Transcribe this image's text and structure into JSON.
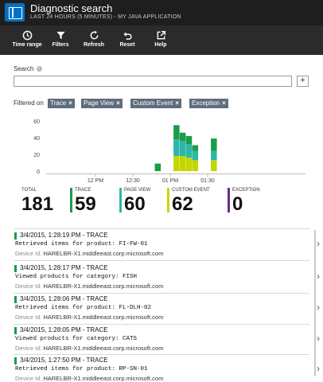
{
  "header": {
    "title": "Diagnostic search",
    "subtitle": "LAST 24 HOURS (5 MINUTES) - MY JAVA APPLICATION",
    "icon": "diagnostic-search-icon"
  },
  "toolbar": {
    "items": [
      {
        "label": "Time range",
        "icon": "clock-icon"
      },
      {
        "label": "Filters",
        "icon": "funnel-icon"
      },
      {
        "label": "Refresh",
        "icon": "refresh-icon"
      },
      {
        "label": "Reset",
        "icon": "undo-icon"
      },
      {
        "label": "Help",
        "icon": "external-link-icon"
      }
    ]
  },
  "search": {
    "label": "Search",
    "info": "i",
    "value": "",
    "add_label": "+"
  },
  "filters": {
    "label": "Filtered on",
    "remove_symbol": "×",
    "chips": [
      "Trace",
      "Page View",
      "Custom Event",
      "Exception"
    ]
  },
  "colors": {
    "trace": "#1a9c48",
    "page_view": "#2eb6a7",
    "custom_event": "#c4d600",
    "exception": "#6b2d8b"
  },
  "chart_data": {
    "type": "bar",
    "stacked": true,
    "y_ticks": [
      "60",
      "40",
      "20",
      "0"
    ],
    "ylim": [
      0,
      60
    ],
    "x_ticks": [
      "12 PM",
      "12:30",
      "01 PM",
      "01:30"
    ],
    "x": [
      "12:50",
      "12:55",
      "13:00",
      "13:05",
      "13:10",
      "13:15",
      "13:20",
      "13:25",
      "13:30",
      "13:35"
    ],
    "series": [
      {
        "key": "custom_event",
        "values": [
          0,
          0,
          0,
          18,
          18,
          16,
          13,
          0,
          0,
          13
        ]
      },
      {
        "key": "page_view",
        "values": [
          0,
          0,
          0,
          20,
          18,
          16,
          11,
          0,
          0,
          11
        ]
      },
      {
        "key": "trace",
        "values": [
          9,
          0,
          0,
          17,
          10,
          10,
          7,
          0,
          0,
          15
        ]
      }
    ],
    "grid": false
  },
  "totals": [
    {
      "label": "TOTAL",
      "value": "181"
    },
    {
      "label": "TRACE",
      "value": "59"
    },
    {
      "label": "PAGE VIEW",
      "value": "60"
    },
    {
      "label": "CUSTOM EVENT",
      "value": "62"
    },
    {
      "label": "EXCEPTION",
      "value": "0"
    }
  ],
  "results": [
    {
      "title": "3/4/2015, 1:28:19 PM - TRACE",
      "message": "Retrieved items for product: FI-FW-01",
      "device_label": "Device Id:",
      "device": "HARELBR-X1.middleeast.corp.microsoft.com"
    },
    {
      "title": "3/4/2015, 1:28:17 PM - TRACE",
      "message": "Viewed products for category: FISH",
      "device_label": "Device Id:",
      "device": "HARELBR-X1.middleeast.corp.microsoft.com"
    },
    {
      "title": "3/4/2015, 1:28:06 PM - TRACE",
      "message": "Retrieved items for product: FL-DLH-02",
      "device_label": "Device Id:",
      "device": "HARELBR-X1.middleeast.corp.microsoft.com"
    },
    {
      "title": "3/4/2015, 1:28:05 PM - TRACE",
      "message": "Viewed products for category: CATS",
      "device_label": "Device Id:",
      "device": "HARELBR-X1.middleeast.corp.microsoft.com"
    },
    {
      "title": "3/4/2015, 1:27:50 PM - TRACE",
      "message": "Retrieved items for product: RP-SN-01",
      "device_label": "Device Id:",
      "device": "HARELBR-X1.middleeast.corp.microsoft.com"
    }
  ],
  "chevron": "›"
}
